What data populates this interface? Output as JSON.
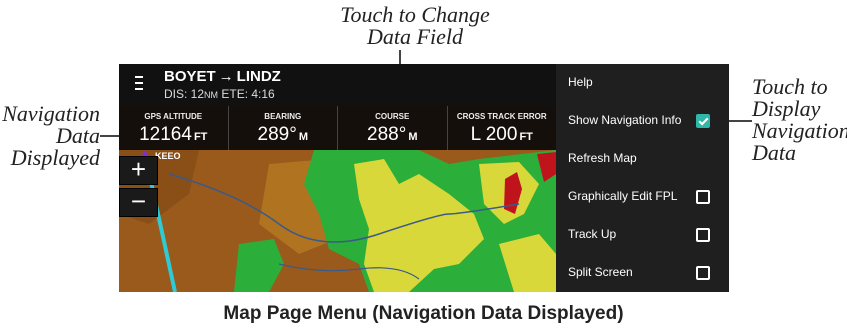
{
  "callouts": {
    "top": [
      "Touch to Change",
      "Data Field"
    ],
    "left": [
      "Navigation",
      "Data",
      "Displayed"
    ],
    "right": [
      "Touch to",
      "Display",
      "Navigation",
      "Data"
    ]
  },
  "header": {
    "route": "BOYET → LINDZ",
    "dis_label": "DIS: 12",
    "dis_unit": "NM",
    "ete": " ETE: 4:16"
  },
  "nav_fields": [
    {
      "label": "GPS ALTITUDE",
      "value": "12164",
      "unit": "FT"
    },
    {
      "label": "BEARING",
      "value": "289°",
      "unit": "M"
    },
    {
      "label": "COURSE",
      "value": "288°",
      "unit": "M"
    },
    {
      "label": "CROSS TRACK ERROR",
      "value": "L 200",
      "unit": "FT"
    }
  ],
  "zoom": {
    "in": "+",
    "out": "−"
  },
  "waypoint_label": "KEEO",
  "menu": {
    "help": "Help",
    "show_nav_info": {
      "label": "Show Navigation Info",
      "checked": true
    },
    "refresh_map": "Refresh Map",
    "graphically_edit": {
      "label": "Graphically Edit FPL",
      "checked": false
    },
    "track_up": {
      "label": "Track Up",
      "checked": false
    },
    "split_screen": {
      "label": "Split Screen",
      "checked": false
    }
  },
  "caption": "Map Page Menu (Navigation Data Displayed)",
  "colors": {
    "accent": "#2fb7a7",
    "terrain_brown": "#9a5a1c",
    "terrain_green": "#2cae3a",
    "terrain_yellow": "#d9d83a",
    "terrain_red": "#c0141c",
    "course_line": "#2ecbd6"
  }
}
